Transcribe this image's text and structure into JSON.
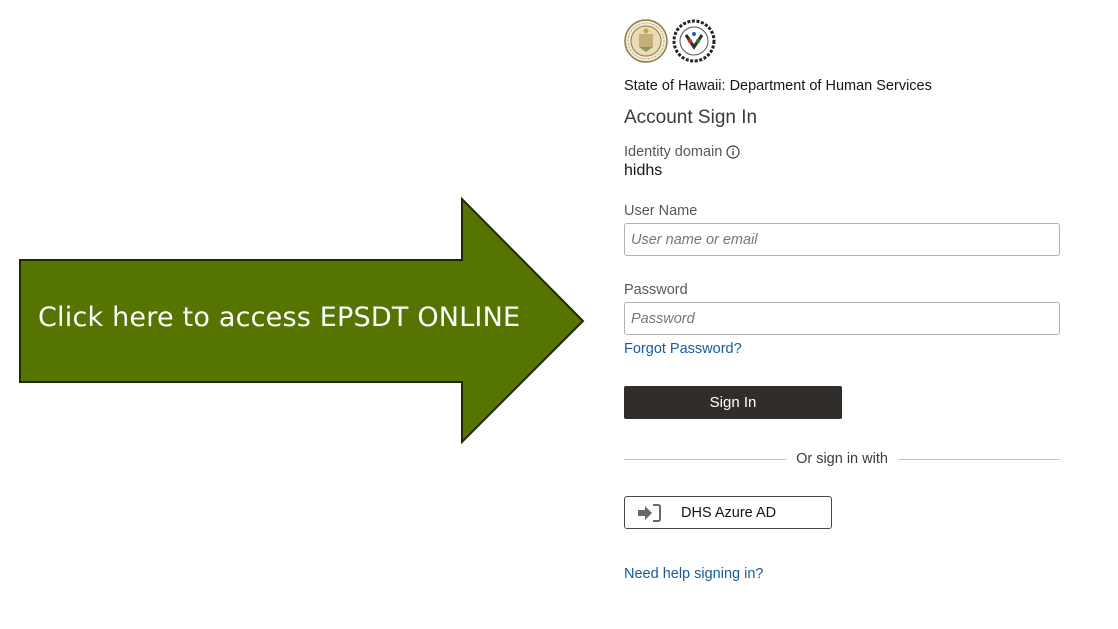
{
  "callout": {
    "text": "Click here to access EPSDT ONLINE",
    "arrow_color": "#567500"
  },
  "header": {
    "logos": [
      "state-seal-icon",
      "dhs-seal-icon"
    ],
    "org_name": "State of Hawaii: Department of Human Services",
    "heading": "Account Sign In"
  },
  "identity_domain": {
    "label": "Identity domain",
    "value": "hidhs",
    "info_icon": "info-icon"
  },
  "form": {
    "username_label": "User Name",
    "username_placeholder": "User name or email",
    "password_label": "Password",
    "password_placeholder": "Password",
    "forgot_password": "Forgot Password?",
    "sign_in": "Sign In"
  },
  "alt_signin": {
    "divider_text": "Or sign in with",
    "provider_label": "DHS Azure AD",
    "provider_icon": "sign-in-arrow-icon"
  },
  "help_link": "Need help signing in?",
  "colors": {
    "link": "#145c9e",
    "button_dark": "#312d2a",
    "arrow_fill": "#567500"
  }
}
